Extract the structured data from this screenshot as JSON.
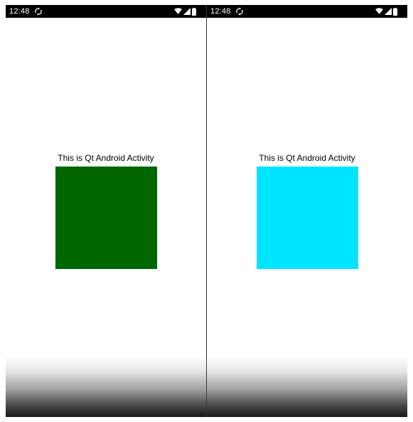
{
  "screens": [
    {
      "status": {
        "time": "12:48",
        "sync_icon": "sync-icon",
        "wifi_icon": "wifi-icon",
        "signal_icon": "signal-icon",
        "battery_icon": "battery-icon"
      },
      "label": "This is Qt Android Activity",
      "square_color": "#006600"
    },
    {
      "status": {
        "time": "12:48",
        "sync_icon": "sync-icon",
        "wifi_icon": "wifi-icon",
        "signal_icon": "signal-icon",
        "battery_icon": "battery-icon"
      },
      "label": "This is Qt Android Activity",
      "square_color": "#00e5ff"
    }
  ],
  "colors": {
    "status_bar": "#000000",
    "background": "#ffffff"
  }
}
